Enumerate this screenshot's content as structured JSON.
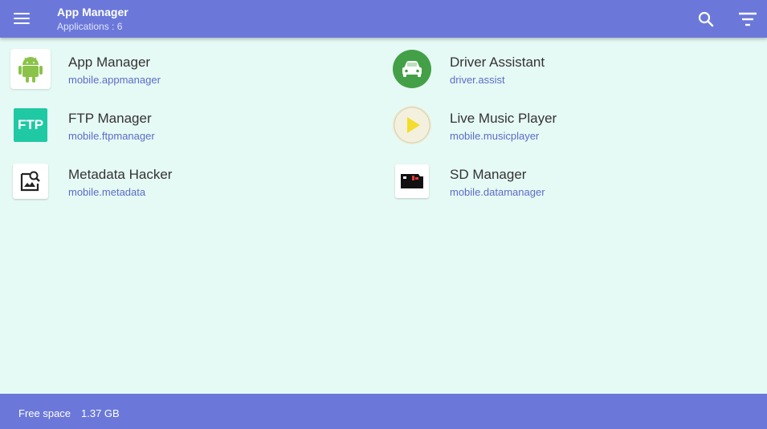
{
  "header": {
    "title": "App Manager",
    "subtitle": "Applications : 6",
    "menu_icon": "menu-icon",
    "search_icon": "search-icon",
    "filter_icon": "filter-icon",
    "color": "#6b78d9"
  },
  "apps": [
    {
      "name": "App Manager",
      "package": "mobile.appmanager",
      "icon": "android-icon"
    },
    {
      "name": "Driver Assistant",
      "package": "driver.assist",
      "icon": "car-icon"
    },
    {
      "name": "FTP Manager",
      "package": "mobile.ftpmanager",
      "icon": "ftp-icon",
      "icon_text": "FTP"
    },
    {
      "name": "Live Music Player",
      "package": "mobile.musicplayer",
      "icon": "play-icon"
    },
    {
      "name": "Metadata Hacker",
      "package": "mobile.metadata",
      "icon": "image-search-icon"
    },
    {
      "name": "SD Manager",
      "package": "mobile.datamanager",
      "icon": "sd-card-icon"
    }
  ],
  "footer": {
    "free_label": "Free space",
    "free_value": "1.37 GB"
  },
  "colors": {
    "background": "#e6faf5",
    "package_text": "#5a6bc9",
    "android_green": "#8bc34a",
    "driver_green": "#43a047",
    "ftp_teal": "#1fc9a4",
    "play_yellow": "#f4dc2c"
  }
}
